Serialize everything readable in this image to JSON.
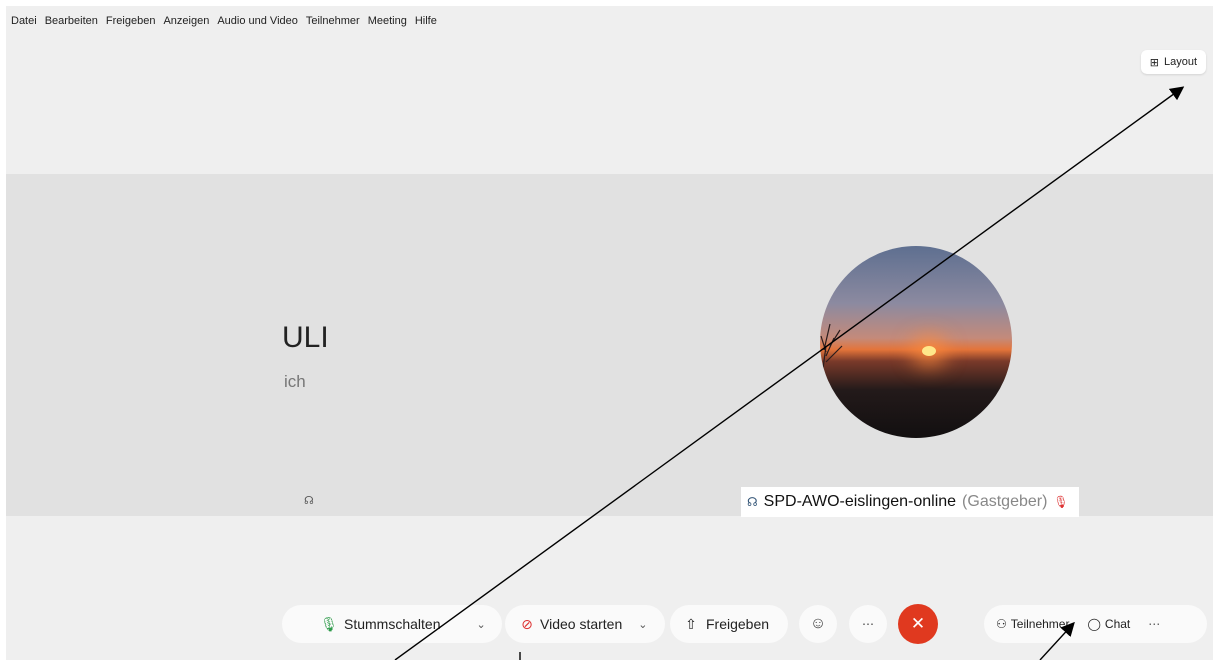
{
  "menu": [
    "Datei",
    "Bearbeiten",
    "Freigeben",
    "Anzeigen",
    "Audio und Video",
    "Teilnehmer",
    "Meeting",
    "Hilfe"
  ],
  "layout_button": {
    "icon": "grid-icon",
    "label": "Layout"
  },
  "participants": [
    {
      "name": "ULI",
      "subtitle": "ich",
      "audio_icon": "headset-icon"
    },
    {
      "name": "SPD-AWO-eislingen-online",
      "role": "(Gastgeber)",
      "audio_icon": "headset-icon",
      "mic_icon": "mic-muted-icon"
    }
  ],
  "toolbar": {
    "mute_label": "Stummschalten",
    "video_label": "Video starten",
    "share_label": "Freigeben",
    "emoji_icon": "smiley-icon",
    "more_icon": "ellipsis-icon",
    "end_icon": "close-icon",
    "participants_label": "Teilnehmer",
    "chat_label": "Chat"
  },
  "colors": {
    "end_call": "#e0391f",
    "mic_green": "#2f9b4b",
    "video_red": "#d33333"
  }
}
